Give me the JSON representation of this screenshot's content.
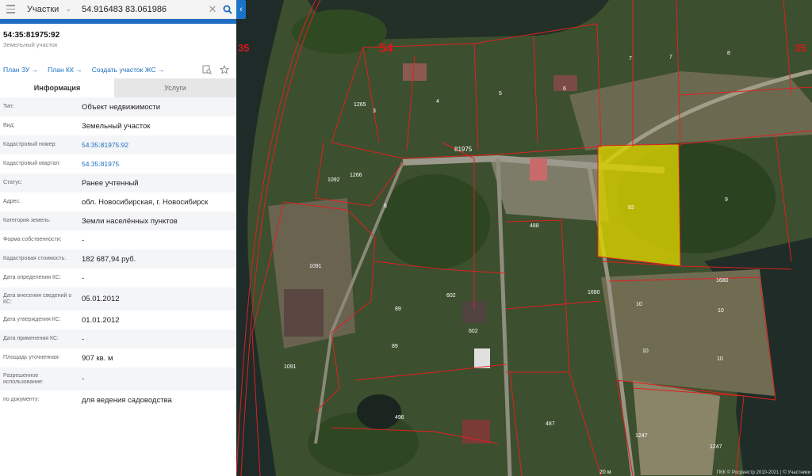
{
  "header": {
    "layer": "Участки",
    "search_value": "54.916483 83.061986"
  },
  "object": {
    "cadastral_number": "54:35:81975:92",
    "type": "Земельный участок"
  },
  "links": {
    "plan_zu": "План ЗУ →",
    "plan_kk": "План КК →",
    "create_zs": "Создать участок ЖС →"
  },
  "tabs": {
    "info": "Информация",
    "services": "Услуги"
  },
  "fields": [
    {
      "label": "Тип:",
      "value": "Объект недвижимости"
    },
    {
      "label": "Вид:",
      "value": "Земельный участок"
    },
    {
      "label": "Кадастровый номер:",
      "value": "54:35:81975:92"
    },
    {
      "label": "Кадастровый квартал:",
      "value": "54:35:81975"
    },
    {
      "label": "Статус:",
      "value": "Ранее учтенный"
    },
    {
      "label": "Адрес:",
      "value": "обл. Новосибирская, г. Новосибирск"
    },
    {
      "label": "Категория земель:",
      "value": "Земли населённых пунктов"
    },
    {
      "label": "Форма собственности:",
      "value": "-"
    },
    {
      "label": "Кадастровая стоимость:",
      "value": "182 687,94 руб."
    },
    {
      "label": "Дата определения КС:",
      "value": "-"
    },
    {
      "label": "Дата внесения сведений о КС:",
      "value": "05.01.2012"
    },
    {
      "label": "Дата утверждения КС:",
      "value": "01.01.2012"
    },
    {
      "label": "Дата применения КС:",
      "value": "-"
    },
    {
      "label": "Площадь уточненная:",
      "value": "907 кв. м"
    },
    {
      "label": "Разрешенное использование:",
      "value": "-"
    },
    {
      "label": "по документу:",
      "value": "для ведения садоводства"
    }
  ],
  "map": {
    "region_54": "54",
    "region_35_left": "35",
    "region_35_right": "35",
    "quarter": "81975",
    "scale": "20 м",
    "attribution": "ПКК © Росреестр 2010-2021 | © Участники",
    "parcels": [
      "1265",
      "3",
      "4",
      "5",
      "6",
      "7",
      "7",
      "8",
      "1092",
      "1266",
      "6",
      "92",
      "9",
      "488",
      "1091",
      "1680",
      "1680",
      "10",
      "10",
      "10",
      "10",
      "602",
      "602",
      "89",
      "89",
      "1091",
      "496",
      "487",
      "1247",
      "1247"
    ],
    "highlight_color": "#d8d000",
    "boundary_color": "#e02020"
  }
}
